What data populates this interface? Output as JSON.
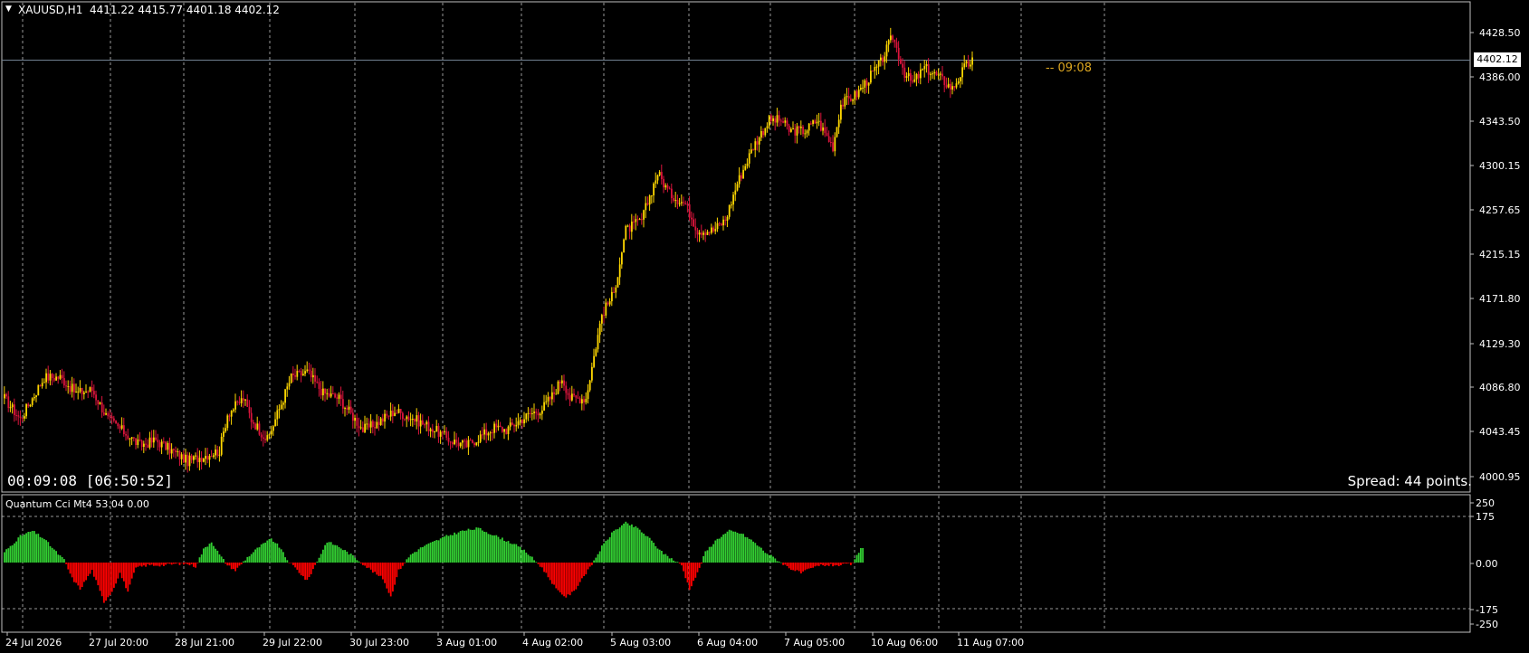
{
  "header": {
    "symbol_timeframe": "XAUUSD,H1",
    "ohlc": "4411.22 4415.77 4401.18 4402.12"
  },
  "colors": {
    "background": "#000000",
    "bull_candle": "#FFD700",
    "bear_candle": "#DC143C",
    "hist_positive": "#32CD32",
    "hist_negative": "#FF0000",
    "grid": "#C0C0C0",
    "countdown": "#DAA520",
    "bid_line": "#708090"
  },
  "overlays": {
    "timer": "00:09:08 [06:50:52]",
    "spread": "Spread: 44 points.",
    "countdown_label": "-- 09:08",
    "current_price": "4402.12"
  },
  "price_axis": {
    "ticks": [
      "4428.50",
      "4386.00",
      "4343.50",
      "4300.15",
      "4257.65",
      "4215.15",
      "4171.80",
      "4129.30",
      "4086.80",
      "4043.45",
      "4000.95"
    ]
  },
  "indicator": {
    "title": "Quantum Cci Mt4 53.04 0.00",
    "levels": [
      "250",
      "175",
      "0.00",
      "-175",
      "-250"
    ]
  },
  "time_axis": {
    "labels": [
      "24 Jul 2026",
      "27 Jul 20:00",
      "28 Jul 21:00",
      "29 Jul 22:00",
      "30 Jul 23:00",
      "3 Aug 01:00",
      "4 Aug 02:00",
      "5 Aug 03:00",
      "6 Aug 04:00",
      "7 Aug 05:00",
      "10 Aug 06:00",
      "11 Aug 07:00"
    ]
  },
  "chart_data": {
    "type": "candlestick",
    "ylim": [
      3990,
      4460
    ],
    "series_close_path": [
      [
        0,
        4080
      ],
      [
        8,
        4060
      ],
      [
        20,
        4100
      ],
      [
        28,
        4100
      ],
      [
        36,
        4085
      ],
      [
        44,
        4088
      ],
      [
        52,
        4060
      ],
      [
        60,
        4048
      ],
      [
        68,
        4035
      ],
      [
        76,
        4040
      ],
      [
        84,
        4030
      ],
      [
        92,
        4020
      ],
      [
        100,
        4025
      ],
      [
        108,
        4030
      ],
      [
        112,
        4065
      ],
      [
        120,
        4080
      ],
      [
        124,
        4060
      ],
      [
        132,
        4040
      ],
      [
        138,
        4070
      ],
      [
        144,
        4100
      ],
      [
        152,
        4105
      ],
      [
        160,
        4085
      ],
      [
        168,
        4080
      ],
      [
        174,
        4065
      ],
      [
        180,
        4050
      ],
      [
        186,
        4055
      ],
      [
        196,
        4068
      ],
      [
        206,
        4060
      ],
      [
        216,
        4050
      ],
      [
        224,
        4040
      ],
      [
        232,
        4035
      ],
      [
        240,
        4045
      ],
      [
        246,
        4052
      ],
      [
        252,
        4050
      ],
      [
        258,
        4058
      ],
      [
        264,
        4065
      ],
      [
        270,
        4070
      ],
      [
        276,
        4085
      ],
      [
        280,
        4100
      ],
      [
        284,
        4080
      ],
      [
        292,
        4080
      ],
      [
        300,
        4160
      ],
      [
        306,
        4180
      ],
      [
        312,
        4240
      ],
      [
        320,
        4250
      ],
      [
        328,
        4295
      ],
      [
        334,
        4275
      ],
      [
        342,
        4265
      ],
      [
        348,
        4240
      ],
      [
        356,
        4240
      ],
      [
        362,
        4250
      ],
      [
        368,
        4285
      ],
      [
        376,
        4320
      ],
      [
        384,
        4345
      ],
      [
        390,
        4345
      ],
      [
        394,
        4335
      ],
      [
        402,
        4335
      ],
      [
        408,
        4345
      ],
      [
        416,
        4320
      ],
      [
        420,
        4360
      ],
      [
        428,
        4370
      ],
      [
        440,
        4400
      ],
      [
        446,
        4425
      ],
      [
        452,
        4390
      ],
      [
        456,
        4380
      ],
      [
        462,
        4395
      ],
      [
        470,
        4385
      ],
      [
        476,
        4375
      ],
      [
        482,
        4395
      ],
      [
        486,
        4402
      ]
    ],
    "cci_histogram_path": [
      [
        0,
        40
      ],
      [
        8,
        100
      ],
      [
        14,
        120
      ],
      [
        20,
        90
      ],
      [
        26,
        40
      ],
      [
        30,
        10
      ],
      [
        34,
        -60
      ],
      [
        38,
        -100
      ],
      [
        44,
        -30
      ],
      [
        50,
        -150
      ],
      [
        54,
        -110
      ],
      [
        58,
        -40
      ],
      [
        62,
        -110
      ],
      [
        66,
        -20
      ],
      [
        72,
        -10
      ],
      [
        80,
        -10
      ],
      [
        86,
        -5
      ],
      [
        92,
        -5
      ],
      [
        96,
        -15
      ],
      [
        100,
        50
      ],
      [
        104,
        80
      ],
      [
        108,
        30
      ],
      [
        112,
        -10
      ],
      [
        116,
        -30
      ],
      [
        122,
        20
      ],
      [
        128,
        60
      ],
      [
        134,
        90
      ],
      [
        138,
        60
      ],
      [
        142,
        10
      ],
      [
        146,
        -20
      ],
      [
        152,
        -70
      ],
      [
        158,
        20
      ],
      [
        162,
        80
      ],
      [
        168,
        60
      ],
      [
        174,
        30
      ],
      [
        180,
        -5
      ],
      [
        186,
        -40
      ],
      [
        190,
        -60
      ],
      [
        194,
        -130
      ],
      [
        198,
        -30
      ],
      [
        204,
        30
      ],
      [
        210,
        60
      ],
      [
        216,
        80
      ],
      [
        222,
        100
      ],
      [
        230,
        120
      ],
      [
        238,
        130
      ],
      [
        244,
        110
      ],
      [
        250,
        90
      ],
      [
        256,
        70
      ],
      [
        262,
        40
      ],
      [
        266,
        10
      ],
      [
        270,
        -20
      ],
      [
        278,
        -110
      ],
      [
        282,
        -130
      ],
      [
        286,
        -110
      ],
      [
        290,
        -60
      ],
      [
        294,
        -20
      ],
      [
        300,
        60
      ],
      [
        306,
        120
      ],
      [
        312,
        150
      ],
      [
        318,
        130
      ],
      [
        324,
        90
      ],
      [
        330,
        40
      ],
      [
        336,
        10
      ],
      [
        340,
        -10
      ],
      [
        344,
        -100
      ],
      [
        348,
        -40
      ],
      [
        352,
        40
      ],
      [
        358,
        90
      ],
      [
        364,
        120
      ],
      [
        370,
        110
      ],
      [
        376,
        80
      ],
      [
        382,
        40
      ],
      [
        388,
        10
      ],
      [
        394,
        -20
      ],
      [
        400,
        -40
      ],
      [
        406,
        -20
      ],
      [
        410,
        -10
      ],
      [
        420,
        -10
      ],
      [
        426,
        -5
      ],
      [
        430,
        55
      ]
    ]
  }
}
